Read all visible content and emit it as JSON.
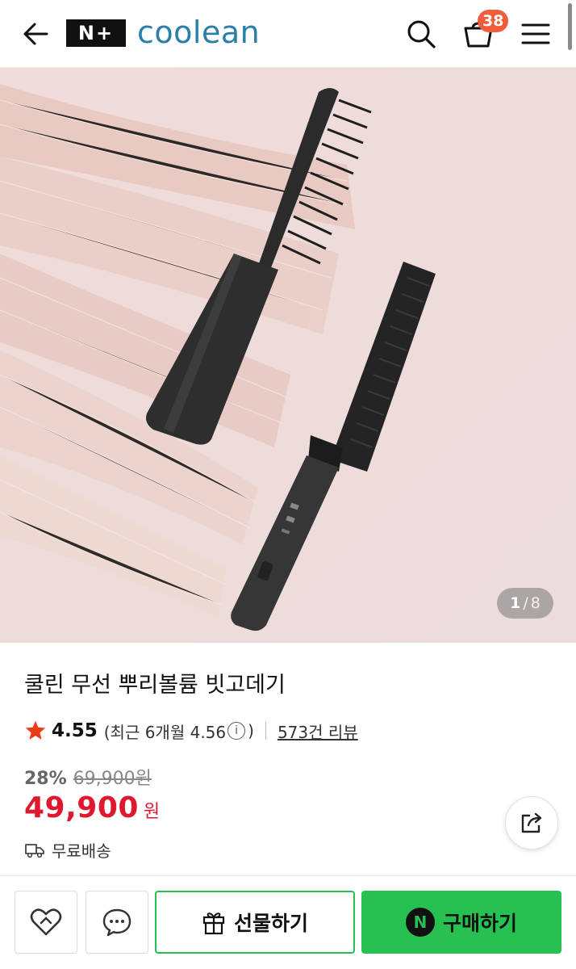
{
  "header": {
    "badge_text": "N+",
    "brand_name": "coolean",
    "brand_color": "#2a7fa9",
    "cart_count": "38",
    "icons": [
      "back-arrow-icon",
      "search-icon",
      "cart-icon",
      "hamburger-menu-icon"
    ]
  },
  "gallery": {
    "current_page": "1",
    "separator": "/",
    "total_pages": "8"
  },
  "product": {
    "title": "쿨린 무선 뿌리볼륨 빗고데기",
    "rating": "4.55",
    "recent_prefix": "(최근 6개월 4.56",
    "recent_suffix": ")",
    "info_glyph": "i",
    "review_count": "573건 리뷰",
    "discount_rate": "28%",
    "original_price": "69,900원",
    "sale_price": "49,900",
    "currency": "원",
    "shipping": "무료배송",
    "sale_color": "#e0182f"
  },
  "bottom_bar": {
    "gift_label": "선물하기",
    "buy_label": "구매하기",
    "buy_badge": "N",
    "accent_color": "#27c152"
  }
}
